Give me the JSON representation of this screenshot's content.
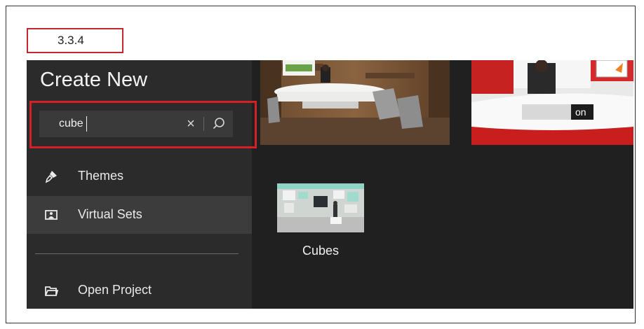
{
  "step": "3.3.4",
  "sidebar": {
    "title": "Create New",
    "search": {
      "value": "cube",
      "clear_icon": "×"
    },
    "items": [
      {
        "label": "Themes",
        "icon": "brush-icon"
      },
      {
        "label": "Virtual Sets",
        "icon": "picture-icon",
        "selected": true
      },
      {
        "label": "Open Project",
        "icon": "folder-icon"
      }
    ]
  },
  "content": {
    "overlay_text": "on",
    "results": [
      {
        "label": "Cubes"
      }
    ]
  },
  "colors": {
    "highlight": "#d42027",
    "sidebar_bg": "#2b2b2b",
    "content_bg": "#202020",
    "selected_bg": "#3c3c3c"
  }
}
